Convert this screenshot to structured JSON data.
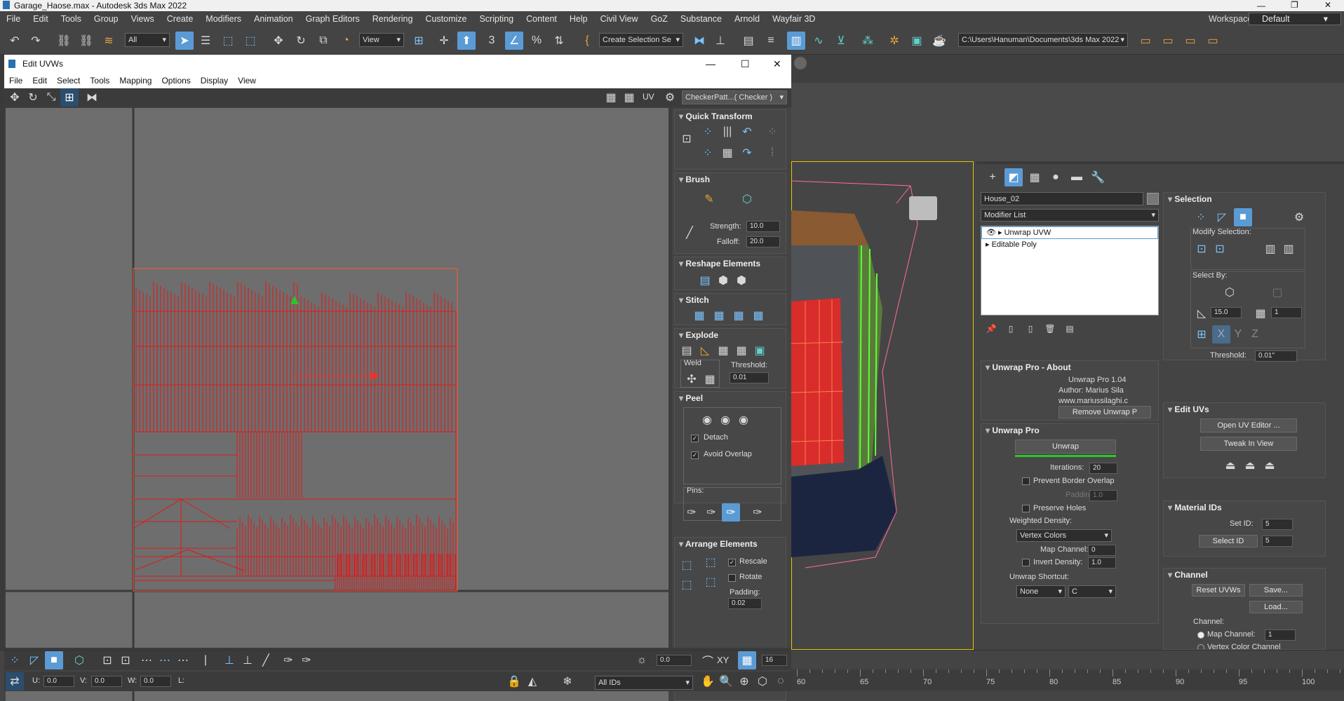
{
  "app": {
    "title": "Garage_Haose.max - Autodesk 3ds Max 2022"
  },
  "menu": [
    "File",
    "Edit",
    "Tools",
    "Group",
    "Views",
    "Create",
    "Modifiers",
    "Animation",
    "Graph Editors",
    "Rendering",
    "Customize",
    "Scripting",
    "Content",
    "Help",
    "Civil View",
    "GoZ",
    "Substance",
    "Arnold",
    "Wayfair 3D"
  ],
  "workspaces": {
    "label": "Workspaces:",
    "value": "Default"
  },
  "toolbar": {
    "filter": "All",
    "ref_coord": "View",
    "selection_set": "Create Selection Se",
    "path": "C:\\Users\\Hanuman\\Documents\\3ds Max 2022"
  },
  "uvw": {
    "title": "Edit UVWs",
    "menu": [
      "File",
      "Edit",
      "Select",
      "Tools",
      "Mapping",
      "Options",
      "Display",
      "View"
    ],
    "uv_label": "UV",
    "texture": "CheckerPatt...( Checker )",
    "rollouts": {
      "quick_transform": "Quick Transform",
      "brush": "Brush",
      "strength_label": "Strength:",
      "strength": "10.0",
      "falloff_label": "Falloff:",
      "falloff": "20.0",
      "reshape": "Reshape Elements",
      "stitch": "Stitch",
      "explode": "Explode",
      "weld": "Weld",
      "threshold_label": "Threshold:",
      "threshold": "0.01",
      "peel": "Peel",
      "detach": "Detach",
      "avoid_overlap": "Avoid Overlap",
      "pins": "Pins:",
      "arrange": "Arrange Elements",
      "rescale": "Rescale",
      "rotate": "Rotate",
      "padding_label": "Padding:",
      "padding": "0.02"
    },
    "bottom": {
      "spin1": "0.0",
      "xy": "XY",
      "spin2": "16",
      "u_label": "U:",
      "u": "0.0",
      "v_label": "V:",
      "v": "0.0",
      "w_label": "W:",
      "w": "0.0",
      "l_label": "L:",
      "ids": "All IDs"
    }
  },
  "cmd": {
    "object_name": "House_02",
    "modifier_list": "Modifier List",
    "stack": [
      "Unwrap UVW",
      "Editable Poly"
    ],
    "about_title": "Unwrap Pro - About",
    "about_lines": [
      "Unwrap Pro 1.04",
      "Author: Marius Sila",
      "www.mariussilaghi.c"
    ],
    "remove_btn": "Remove Unwrap P",
    "unwrap_pro": "Unwrap Pro",
    "unwrap_btn": "Unwrap",
    "iterations_label": "Iterations:",
    "iterations": "20",
    "prevent_border": "Prevent Border Overlap",
    "padding_label": "Padding:",
    "padding": "1.0",
    "preserve_holes": "Preserve Holes",
    "weighted_density": "Weighted Density:",
    "vertex_colors": "Vertex Colors",
    "map_channel_label": "Map Channel:",
    "map_channel": "0",
    "invert_density_label": "Invert Density:",
    "invert_density": "1.0",
    "shortcut_label": "Unwrap Shortcut:",
    "shortcut_mod": "None",
    "shortcut_key": "C"
  },
  "sel_panel": {
    "title": "Selection",
    "modify_selection": "Modify Selection:",
    "select_by": "Select By:",
    "angle": "15.0",
    "grow": "1",
    "threshold_label": "Threshold:",
    "threshold": "0.01\"",
    "edit_uvs": "Edit UVs",
    "open_editor": "Open UV Editor ...",
    "tweak": "Tweak In View",
    "material_ids": "Material IDs",
    "set_id_label": "Set ID:",
    "set_id": "5",
    "select_id_btn": "Select ID",
    "select_id": "5",
    "channel": "Channel",
    "reset_uvws": "Reset UVWs",
    "save": "Save...",
    "load": "Load...",
    "channel_label": "Channel:",
    "map_channel_label": "Map Channel:",
    "map_channel": "1",
    "vertex_color_channel": "Vertex Color Channel"
  },
  "timeline": [
    "60",
    "65",
    "70",
    "75",
    "80",
    "85",
    "90",
    "95",
    "100"
  ]
}
